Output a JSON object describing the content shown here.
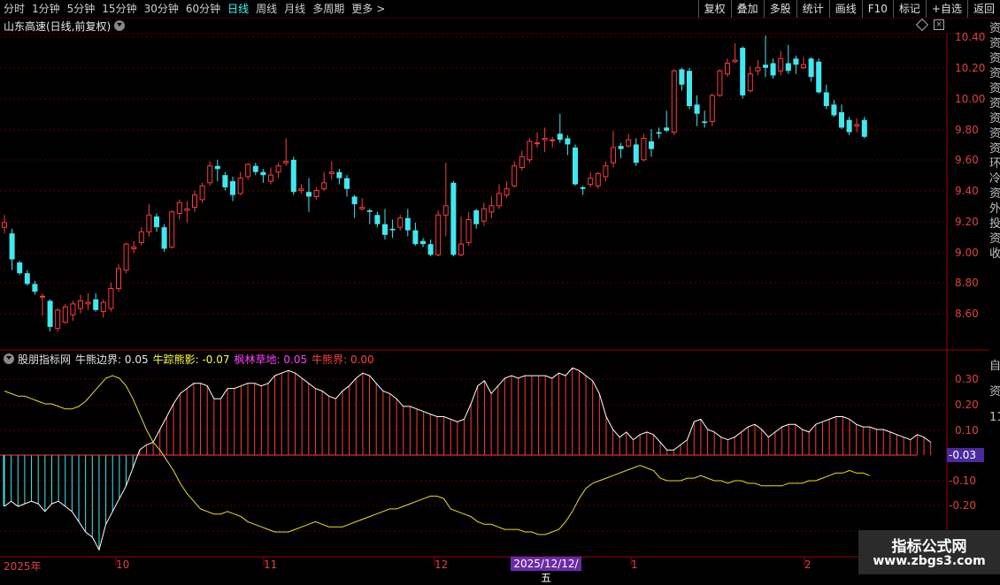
{
  "toolbar": {
    "periods": [
      "分时",
      "1分钟",
      "5分钟",
      "15分钟",
      "30分钟",
      "60分钟",
      "日线",
      "周线",
      "月线",
      "多周期",
      "更多"
    ],
    "active_period": "日线",
    "right_buttons": [
      "复权",
      "叠加",
      "多股",
      "统计",
      "画线",
      "F10",
      "标记",
      "+自选",
      "返回"
    ]
  },
  "stock": {
    "title": "山东高速(日线,前复权)"
  },
  "indicator": {
    "name": "股朋指标网",
    "items": [
      {
        "label": "牛熊边界: 0.05",
        "color": "#e8e8e8"
      },
      {
        "label": "牛踪熊影: -0.07",
        "color": "#ffff40"
      },
      {
        "label": "枫林草地: 0.05",
        "color": "#ff40ff"
      },
      {
        "label": "牛熊界: 0.00",
        "color": "#ff4040"
      }
    ],
    "current_value": "-0.03"
  },
  "price_axis": [
    "10.40",
    "10.20",
    "10.00",
    "9.80",
    "9.60",
    "9.40",
    "9.20",
    "9.00",
    "8.80",
    "8.60"
  ],
  "ind_axis": [
    "0.30",
    "0.20",
    "0.10",
    "-0.10",
    "-0.20"
  ],
  "date_axis": [
    "2025年",
    "10",
    "11",
    "12",
    "1",
    "2"
  ],
  "crosshair_date": "2025/12/12/五",
  "watermark": {
    "line1": "指标公式网",
    "line2": "www.zbgs3.com"
  },
  "colors": {
    "up": "#ff3c3c",
    "down": "#40e8f0",
    "bg": "#000000",
    "grid": "#5a0000"
  },
  "chart_data": {
    "type": "candlestick",
    "candles": [
      [
        9.16,
        9.24,
        9.19,
        9.12
      ],
      [
        9.12,
        9.15,
        8.95,
        8.88
      ],
      [
        8.93,
        8.94,
        8.86,
        8.85
      ],
      [
        8.86,
        8.88,
        8.79,
        8.78
      ],
      [
        8.79,
        8.81,
        8.74,
        8.72
      ],
      [
        8.71,
        8.73,
        8.71,
        8.58
      ],
      [
        8.68,
        8.69,
        8.51,
        8.48
      ],
      [
        8.5,
        8.63,
        8.62,
        8.48
      ],
      [
        8.54,
        8.66,
        8.64,
        8.53
      ],
      [
        8.59,
        8.68,
        8.66,
        8.55
      ],
      [
        8.63,
        8.72,
        8.68,
        8.6
      ],
      [
        8.66,
        8.73,
        8.67,
        8.62
      ],
      [
        8.69,
        8.73,
        8.62,
        8.61
      ],
      [
        8.61,
        8.69,
        8.67,
        8.57
      ],
      [
        8.63,
        8.8,
        8.76,
        8.61
      ],
      [
        8.76,
        8.92,
        8.89,
        8.74
      ],
      [
        8.88,
        9.06,
        9.05,
        8.86
      ],
      [
        9.02,
        9.07,
        9.03,
        8.99
      ],
      [
        9.06,
        9.16,
        9.13,
        9.04
      ],
      [
        9.13,
        9.31,
        9.24,
        9.1
      ],
      [
        9.23,
        9.25,
        9.16,
        9.13
      ],
      [
        9.16,
        9.18,
        9.02,
        9.0
      ],
      [
        9.03,
        9.27,
        9.26,
        9.02
      ],
      [
        9.25,
        9.34,
        9.32,
        9.21
      ],
      [
        9.27,
        9.33,
        9.28,
        9.19
      ],
      [
        9.29,
        9.4,
        9.37,
        9.26
      ],
      [
        9.34,
        9.45,
        9.43,
        9.32
      ],
      [
        9.45,
        9.59,
        9.56,
        9.43
      ],
      [
        9.56,
        9.6,
        9.54,
        9.46
      ],
      [
        9.5,
        9.52,
        9.42,
        9.4
      ],
      [
        9.46,
        9.49,
        9.37,
        9.33
      ],
      [
        9.38,
        9.52,
        9.48,
        9.37
      ],
      [
        9.49,
        9.58,
        9.57,
        9.47
      ],
      [
        9.56,
        9.58,
        9.52,
        9.5
      ],
      [
        9.52,
        9.54,
        9.5,
        9.45
      ],
      [
        9.46,
        9.55,
        9.5,
        9.44
      ],
      [
        9.52,
        9.58,
        9.56,
        9.48
      ],
      [
        9.58,
        9.74,
        9.59,
        9.56
      ],
      [
        9.6,
        9.62,
        9.39,
        9.37
      ],
      [
        9.4,
        9.44,
        9.41,
        9.38
      ],
      [
        9.39,
        9.48,
        9.36,
        9.26
      ],
      [
        9.36,
        9.42,
        9.4,
        9.34
      ],
      [
        9.41,
        9.52,
        9.45,
        9.4
      ],
      [
        9.51,
        9.59,
        9.52,
        9.47
      ],
      [
        9.52,
        9.54,
        9.48,
        9.44
      ],
      [
        9.48,
        9.5,
        9.41,
        9.36
      ],
      [
        9.36,
        9.37,
        9.31,
        9.22
      ],
      [
        9.28,
        9.35,
        9.29,
        9.27
      ],
      [
        9.27,
        9.28,
        9.26,
        9.18
      ],
      [
        9.24,
        9.26,
        9.18,
        9.16
      ],
      [
        9.18,
        9.28,
        9.11,
        9.08
      ],
      [
        9.15,
        9.21,
        9.14,
        9.09
      ],
      [
        9.16,
        9.24,
        9.22,
        9.14
      ],
      [
        9.22,
        9.28,
        9.14,
        9.1
      ],
      [
        9.14,
        9.19,
        9.05,
        9.04
      ],
      [
        9.07,
        9.09,
        9.05,
        9.03
      ],
      [
        9.05,
        9.08,
        8.98,
        8.97
      ],
      [
        8.98,
        9.27,
        9.24,
        8.97
      ],
      [
        9.24,
        9.58,
        9.3,
        9.1
      ],
      [
        9.45,
        9.46,
        8.98,
        8.97
      ],
      [
        8.98,
        9.23,
        9.05,
        8.97
      ],
      [
        9.06,
        9.26,
        9.21,
        9.04
      ],
      [
        9.27,
        9.28,
        9.18,
        9.15
      ],
      [
        9.2,
        9.32,
        9.28,
        9.17
      ],
      [
        9.26,
        9.36,
        9.3,
        9.22
      ],
      [
        9.3,
        9.44,
        9.38,
        9.28
      ],
      [
        9.37,
        9.46,
        9.41,
        9.35
      ],
      [
        9.43,
        9.59,
        9.56,
        9.42
      ],
      [
        9.55,
        9.66,
        9.62,
        9.53
      ],
      [
        9.6,
        9.74,
        9.72,
        9.58
      ],
      [
        9.71,
        9.78,
        9.71,
        9.68
      ],
      [
        9.73,
        9.81,
        9.74,
        9.65
      ],
      [
        9.73,
        9.75,
        9.73,
        9.68
      ],
      [
        9.77,
        9.9,
        9.73,
        9.71
      ],
      [
        9.74,
        9.76,
        9.7,
        9.63
      ],
      [
        9.68,
        9.7,
        9.44,
        9.43
      ],
      [
        9.42,
        9.43,
        9.41,
        9.37
      ],
      [
        9.44,
        9.52,
        9.48,
        9.42
      ],
      [
        9.43,
        9.52,
        9.51,
        9.41
      ],
      [
        9.49,
        9.59,
        9.56,
        9.46
      ],
      [
        9.58,
        9.79,
        9.68,
        9.55
      ],
      [
        9.69,
        9.71,
        9.67,
        9.61
      ],
      [
        9.69,
        9.77,
        9.73,
        9.68
      ],
      [
        9.7,
        9.74,
        9.58,
        9.56
      ],
      [
        9.6,
        9.77,
        9.74,
        9.59
      ],
      [
        9.72,
        9.8,
        9.67,
        9.62
      ],
      [
        9.78,
        9.81,
        9.77,
        9.74
      ],
      [
        9.81,
        9.92,
        9.79,
        9.78
      ],
      [
        9.78,
        10.19,
        10.18,
        9.76
      ],
      [
        10.19,
        10.2,
        10.09,
        10.05
      ],
      [
        10.18,
        10.2,
        9.95,
        9.93
      ],
      [
        9.96,
        10.02,
        9.9,
        9.82
      ],
      [
        9.85,
        9.92,
        9.84,
        9.81
      ],
      [
        9.85,
        10.03,
        10.02,
        9.82
      ],
      [
        10.02,
        10.19,
        10.18,
        10.01
      ],
      [
        10.16,
        10.26,
        10.23,
        10.14
      ],
      [
        10.24,
        10.36,
        10.25,
        10.23
      ],
      [
        10.33,
        10.34,
        10.02,
        10.0
      ],
      [
        10.05,
        10.21,
        10.16,
        10.04
      ],
      [
        10.18,
        10.25,
        10.2,
        10.15
      ],
      [
        10.22,
        10.41,
        10.2,
        10.14
      ],
      [
        10.23,
        10.26,
        10.15,
        10.13
      ],
      [
        10.18,
        10.31,
        10.26,
        10.15
      ],
      [
        10.23,
        10.35,
        10.18,
        10.16
      ],
      [
        10.26,
        10.28,
        10.22,
        10.16
      ],
      [
        10.2,
        10.27,
        10.22,
        10.19
      ],
      [
        10.26,
        10.27,
        10.14,
        10.11
      ],
      [
        10.24,
        10.26,
        10.04,
        10.03
      ],
      [
        10.04,
        10.09,
        9.95,
        9.93
      ],
      [
        9.96,
        9.99,
        9.89,
        9.88
      ],
      [
        9.91,
        9.96,
        9.81,
        9.8
      ],
      [
        9.86,
        9.88,
        9.78,
        9.76
      ],
      [
        9.82,
        9.87,
        9.83,
        9.78
      ],
      [
        9.86,
        9.88,
        9.75,
        9.74
      ]
    ],
    "indicator_bars": [
      -0.2,
      -0.18,
      -0.2,
      -0.19,
      -0.18,
      -0.19,
      -0.22,
      -0.19,
      -0.18,
      -0.2,
      -0.22,
      -0.26,
      -0.3,
      -0.32,
      -0.37,
      -0.27,
      -0.22,
      -0.17,
      -0.12,
      -0.05,
      0.02,
      0.04,
      0.05,
      0.1,
      0.15,
      0.2,
      0.24,
      0.26,
      0.28,
      0.28,
      0.27,
      0.22,
      0.22,
      0.26,
      0.26,
      0.27,
      0.28,
      0.28,
      0.27,
      0.28,
      0.31,
      0.32,
      0.33,
      0.32,
      0.3,
      0.28,
      0.26,
      0.25,
      0.23,
      0.22,
      0.25,
      0.27,
      0.3,
      0.32,
      0.31,
      0.28,
      0.25,
      0.24,
      0.22,
      0.19,
      0.19,
      0.18,
      0.17,
      0.16,
      0.15,
      0.15,
      0.14,
      0.13,
      0.14,
      0.2,
      0.27,
      0.29,
      0.24,
      0.27,
      0.3,
      0.31,
      0.3,
      0.31,
      0.31,
      0.31,
      0.31,
      0.3,
      0.32,
      0.31,
      0.34,
      0.33,
      0.31,
      0.29,
      0.24,
      0.15,
      0.1,
      0.07,
      0.09,
      0.06,
      0.08,
      0.09,
      0.08,
      0.05,
      0.02,
      0.02,
      0.04,
      0.06,
      0.13,
      0.14,
      0.1,
      0.09,
      0.07,
      0.06,
      0.07,
      0.09,
      0.11,
      0.12,
      0.1,
      0.07,
      0.09,
      0.11,
      0.12,
      0.12,
      0.1,
      0.09,
      0.12,
      0.13,
      0.14,
      0.15,
      0.15,
      0.14,
      0.12,
      0.11,
      0.11,
      0.1,
      0.1,
      0.09,
      0.08,
      0.07,
      0.06,
      0.08,
      0.07,
      0.05
    ],
    "yellow_line": [
      0.25,
      0.24,
      0.23,
      0.23,
      0.22,
      0.21,
      0.2,
      0.2,
      0.19,
      0.18,
      0.18,
      0.19,
      0.21,
      0.24,
      0.27,
      0.3,
      0.31,
      0.3,
      0.27,
      0.22,
      0.16,
      0.1,
      0.05,
      0.02,
      -0.02,
      -0.06,
      -0.11,
      -0.15,
      -0.18,
      -0.21,
      -0.22,
      -0.23,
      -0.23,
      -0.22,
      -0.23,
      -0.24,
      -0.26,
      -0.27,
      -0.28,
      -0.29,
      -0.3,
      -0.3,
      -0.3,
      -0.29,
      -0.28,
      -0.27,
      -0.26,
      -0.27,
      -0.28,
      -0.28,
      -0.28,
      -0.27,
      -0.26,
      -0.25,
      -0.24,
      -0.23,
      -0.22,
      -0.21,
      -0.21,
      -0.2,
      -0.19,
      -0.18,
      -0.17,
      -0.16,
      -0.16,
      -0.17,
      -0.21,
      -0.22,
      -0.23,
      -0.24,
      -0.26,
      -0.27,
      -0.27,
      -0.28,
      -0.29,
      -0.29,
      -0.29,
      -0.3,
      -0.3,
      -0.31,
      -0.31,
      -0.3,
      -0.29,
      -0.26,
      -0.22,
      -0.17,
      -0.13,
      -0.11,
      -0.1,
      -0.09,
      -0.08,
      -0.07,
      -0.06,
      -0.05,
      -0.04,
      -0.05,
      -0.06,
      -0.09,
      -0.1,
      -0.1,
      -0.1,
      -0.09,
      -0.09,
      -0.08,
      -0.09,
      -0.1,
      -0.1,
      -0.11,
      -0.1,
      -0.1,
      -0.11,
      -0.11,
      -0.12,
      -0.12,
      -0.12,
      -0.12,
      -0.11,
      -0.11,
      -0.11,
      -0.1,
      -0.1,
      -0.09,
      -0.08,
      -0.07,
      -0.07,
      -0.06,
      -0.07,
      -0.07,
      -0.08
    ]
  }
}
